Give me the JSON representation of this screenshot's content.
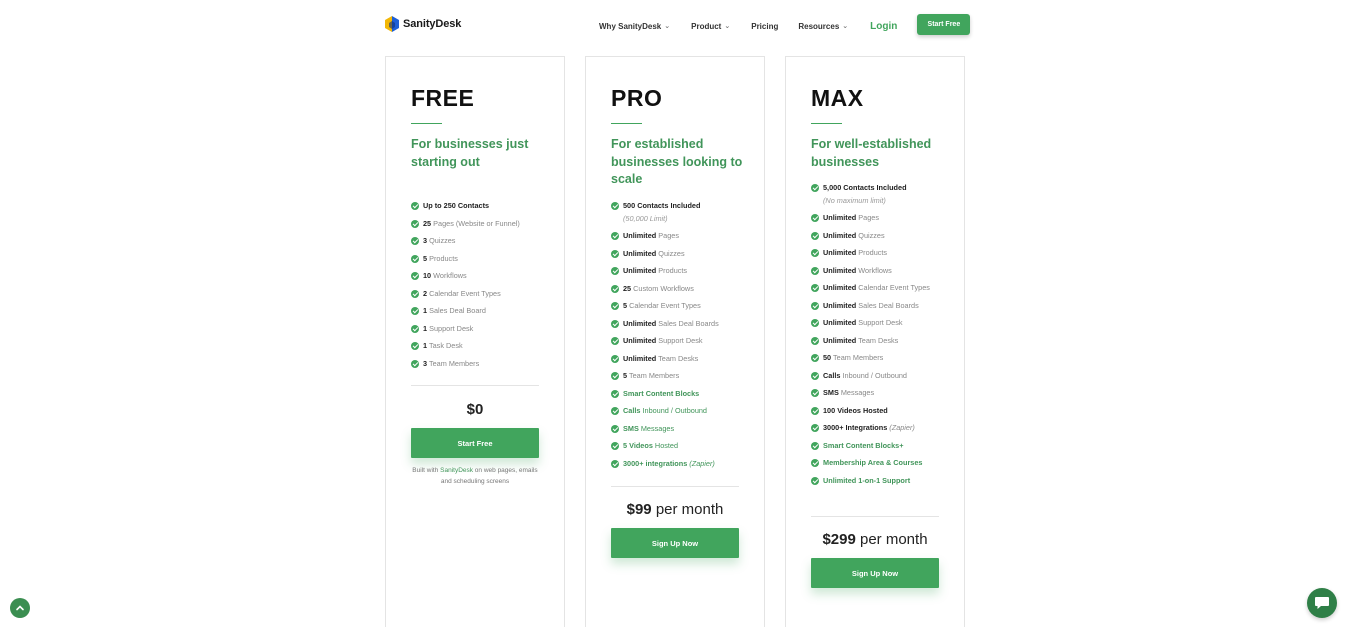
{
  "brand": {
    "name": "SanityDesk",
    "colors": {
      "accent": "#41a55d",
      "accent_text": "#41955a",
      "logo_blue": "#1e5fd6",
      "logo_yellow": "#f2b705"
    }
  },
  "nav": {
    "items": [
      {
        "label": "Why SanityDesk",
        "dropdown": true
      },
      {
        "label": "Product",
        "dropdown": true
      },
      {
        "label": "Pricing",
        "dropdown": false
      },
      {
        "label": "Resources",
        "dropdown": true
      }
    ],
    "login": "Login",
    "cta": "Start Free"
  },
  "plans": {
    "free": {
      "name": "FREE",
      "tagline": "For businesses just starting out",
      "features": [
        {
          "bold": "Up to 250 Contacts",
          "text": ""
        },
        {
          "bold": "25",
          "text": " Pages (Website or Funnel)"
        },
        {
          "bold": "3",
          "text": " Quizzes"
        },
        {
          "bold": "5",
          "text": " Products"
        },
        {
          "bold": "10",
          "text": " Workflows"
        },
        {
          "bold": "2",
          "text": " Calendar Event Types"
        },
        {
          "bold": "1",
          "text": " Sales Deal Board"
        },
        {
          "bold": "1",
          "text": " Support Desk"
        },
        {
          "bold": "1",
          "text": " Task Desk"
        },
        {
          "bold": "3",
          "text": " Team Members"
        }
      ],
      "price_amount": "$0",
      "price_period": "",
      "button": "Start Free",
      "footnote_prefix": "Built with ",
      "footnote_link": "SanityDesk",
      "footnote_suffix": " on web pages, emails and scheduling screens"
    },
    "pro": {
      "name": "PRO",
      "tagline": "For established businesses looking to scale",
      "features": [
        {
          "bold": "500 Contacts Included",
          "text": "",
          "sub": "(50,000 Limit)"
        },
        {
          "bold": "Unlimited",
          "text": " Pages"
        },
        {
          "bold": "Unlimited",
          "text": " Quizzes"
        },
        {
          "bold": "Unlimited",
          "text": " Products"
        },
        {
          "bold": "25",
          "text": " Custom Workflows"
        },
        {
          "bold": "5",
          "text": " Calendar Event Types"
        },
        {
          "bold": "Unlimited",
          "text": " Sales Deal Boards"
        },
        {
          "bold": "Unlimited",
          "text": " Support Desk"
        },
        {
          "bold": "Unlimited",
          "text": " Team Desks"
        },
        {
          "bold": "5",
          "text": " Team Members"
        },
        {
          "bold": "Smart Content Blocks",
          "text": "",
          "accent": true
        },
        {
          "bold": "Calls",
          "text": " Inbound / Outbound",
          "accent": true
        },
        {
          "bold": "SMS",
          "text": " Messages",
          "accent": true
        },
        {
          "bold": "5 Videos",
          "text": " Hosted",
          "accent": true
        },
        {
          "bold": "3000+ integrations",
          "text": " (Zapier)",
          "accent": true,
          "italic_text": true
        }
      ],
      "price_amount": "$99",
      "price_period": " per month",
      "button": "Sign Up Now"
    },
    "max": {
      "name": "MAX",
      "tagline": "For well-established businesses",
      "features": [
        {
          "bold": "5,000 Contacts Included",
          "text": "",
          "sub": "(No maximum limit)"
        },
        {
          "bold": "Unlimited",
          "text": " Pages"
        },
        {
          "bold": "Unlimited",
          "text": " Quizzes"
        },
        {
          "bold": "Unlimited",
          "text": " Products"
        },
        {
          "bold": "Unlimited",
          "text": " Workflows"
        },
        {
          "bold": "Unlimited",
          "text": " Calendar Event Types"
        },
        {
          "bold": "Unlimited",
          "text": " Sales Deal Boards"
        },
        {
          "bold": "Unlimited",
          "text": " Support Desk"
        },
        {
          "bold": "Unlimited",
          "text": " Team Desks"
        },
        {
          "bold": "50",
          "text": " Team Members"
        },
        {
          "bold": "Calls",
          "text": " Inbound / Outbound"
        },
        {
          "bold": "SMS",
          "text": " Messages"
        },
        {
          "bold": "100 Videos Hosted",
          "text": ""
        },
        {
          "bold": "3000+ Integrations",
          "text": " (Zapier)",
          "italic_text": true
        },
        {
          "bold": "Smart Content Blocks+",
          "text": "",
          "accent": true
        },
        {
          "bold": "Membership Area & Courses",
          "text": "",
          "accent": true
        },
        {
          "bold": "Unlimited 1-on-1 Support",
          "text": "",
          "accent": true
        }
      ],
      "price_amount": "$299",
      "price_period": " per month",
      "button": "Sign Up Now"
    }
  },
  "floating": {
    "scroll_top_icon": "chevron-up-icon",
    "chat_icon": "chat-bubble-icon"
  }
}
